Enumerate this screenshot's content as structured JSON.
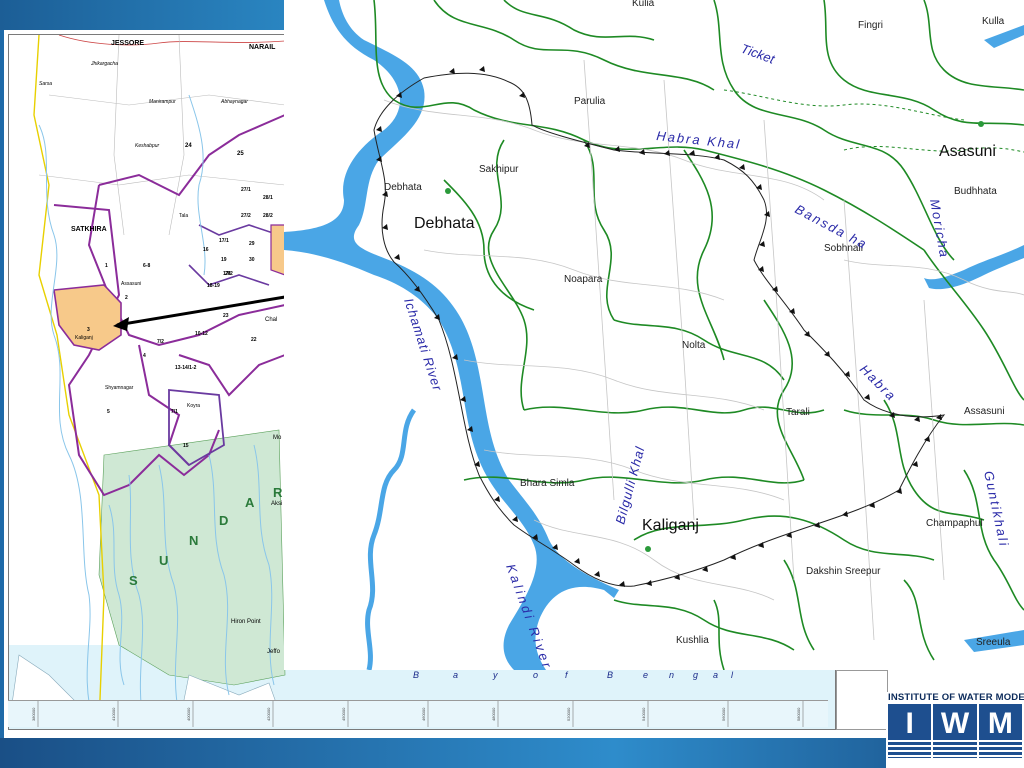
{
  "overview_map": {
    "district_labels": [
      "JESSORE",
      "NARAIL",
      "SATKHIRA"
    ],
    "place_labels": [
      "Jhikargacha",
      "Sarsa",
      "Manirampur",
      "Abhaynagar",
      "Keshabpur",
      "Tala",
      "Assasuni",
      "Kaliganj",
      "Shyamnagar",
      "Koyra",
      "Hiron Point",
      "Jeffo",
      "Mo",
      "Chal",
      "Aksi"
    ],
    "polder_labels": [
      "24",
      "25",
      "27/1",
      "28/1",
      "27/2",
      "28/2",
      "17/1",
      "17/2",
      "16",
      "19",
      "29",
      "30",
      "6-8",
      "1",
      "2",
      "3",
      "4",
      "5",
      "7/1",
      "7/2",
      "13-14/1-2",
      "10-12",
      "15",
      "23",
      "22",
      "20",
      "18-19"
    ],
    "forest_label": [
      "S",
      "U",
      "N",
      "D",
      "A",
      "R"
    ],
    "sea_label": [
      "B",
      "a",
      "y",
      "o",
      "f",
      "B",
      "e",
      "n",
      "g",
      "a",
      "l"
    ],
    "grid_ticks": [
      "380000",
      "410000",
      "400000",
      "420000",
      "450000",
      "460000",
      "480000",
      "520000",
      "540000",
      "560000",
      "580000",
      "600000"
    ]
  },
  "detail_map": {
    "upazila_labels": [
      "Debhata",
      "Kaliganj",
      "Asasuni"
    ],
    "union_labels": [
      "Kulia",
      "Fingri",
      "Kulla",
      "Parulia",
      "Debhata",
      "Sakhipur",
      "Noapara",
      "Nolta",
      "Tarali",
      "Bhara Simla",
      "Budhhata",
      "Sobhnali",
      "Assasuni",
      "Champaphul",
      "Dakshin Sreepur",
      "Kushlia",
      "Sreeula"
    ],
    "river_labels": [
      "Ticket",
      "Habra Khal",
      "Bansda ha",
      "Moricha",
      "Habra",
      "Ichamati River",
      "Bilgulli Khal",
      "Kalindi River",
      "Guntikhali"
    ]
  },
  "logo": {
    "org_name": "INSTITUTE OF WATER MODELLING",
    "letters": [
      "I",
      "W",
      "M"
    ]
  },
  "colors": {
    "river": "#4aa6e6",
    "boundary_green": "#1e8a24",
    "polder_purple": "#8b2c9a",
    "highlight_orange": "#f7c98a",
    "forest": "#cfe8d4",
    "sea": "#dff3fa",
    "brand_blue": "#1e4f8f"
  }
}
